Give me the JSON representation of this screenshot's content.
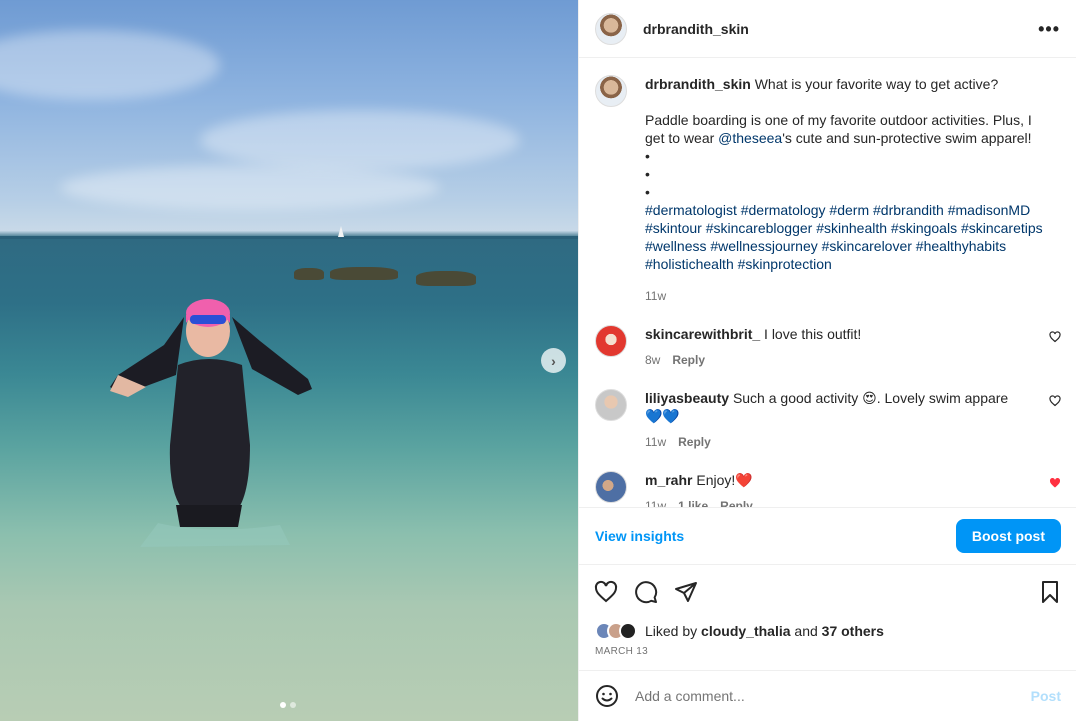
{
  "post": {
    "author": "drbrandith_skin",
    "more_label": "•••",
    "caption": {
      "author": "drbrandith_skin",
      "line1": "What is your favorite way to get active?",
      "para_part1": "Paddle boarding is one of my favorite outdoor activities. Plus, I get to wear ",
      "mention": "@theseea",
      "para_part2": "'s cute and sun-protective swim apparel!",
      "bullet": "•",
      "hashtags": "#dermatologist #dermatology #derm #drbrandith #madisonMD #skintour #skincareblogger #skinhealth #skingoals #skincaretips #wellness #wellnessjourney #skincarelover #healthyhabits #holistichealth #skinprotection",
      "time": "11w"
    }
  },
  "comments": [
    {
      "user": "skincarewithbrit_",
      "text": "I love this outfit!",
      "time": "8w",
      "likes": "",
      "reply": "Reply",
      "liked": false
    },
    {
      "user": "liliyasbeauty",
      "text": "Such a good activity 😍. Lovely swim appare💙💙",
      "time": "11w",
      "likes": "",
      "reply": "Reply",
      "liked": false
    },
    {
      "user": "m_rahr",
      "text": "Enjoy!❤️",
      "time": "11w",
      "likes": "1 like",
      "reply": "Reply",
      "liked": true
    }
  ],
  "insights": {
    "view_label": "View insights",
    "boost_label": "Boost post"
  },
  "likes": {
    "prefix": "Liked by",
    "user": "cloudy_thalia",
    "mid": "and",
    "others": "37 others"
  },
  "date": "MARCH 13",
  "add_comment": {
    "placeholder": "Add a comment...",
    "post_label": "Post"
  },
  "carousel": {
    "slide_count": 2,
    "active_slide": 1
  },
  "colors": {
    "link": "#00376b",
    "accent": "#0095f6",
    "liked_heart": "#ff3040"
  }
}
